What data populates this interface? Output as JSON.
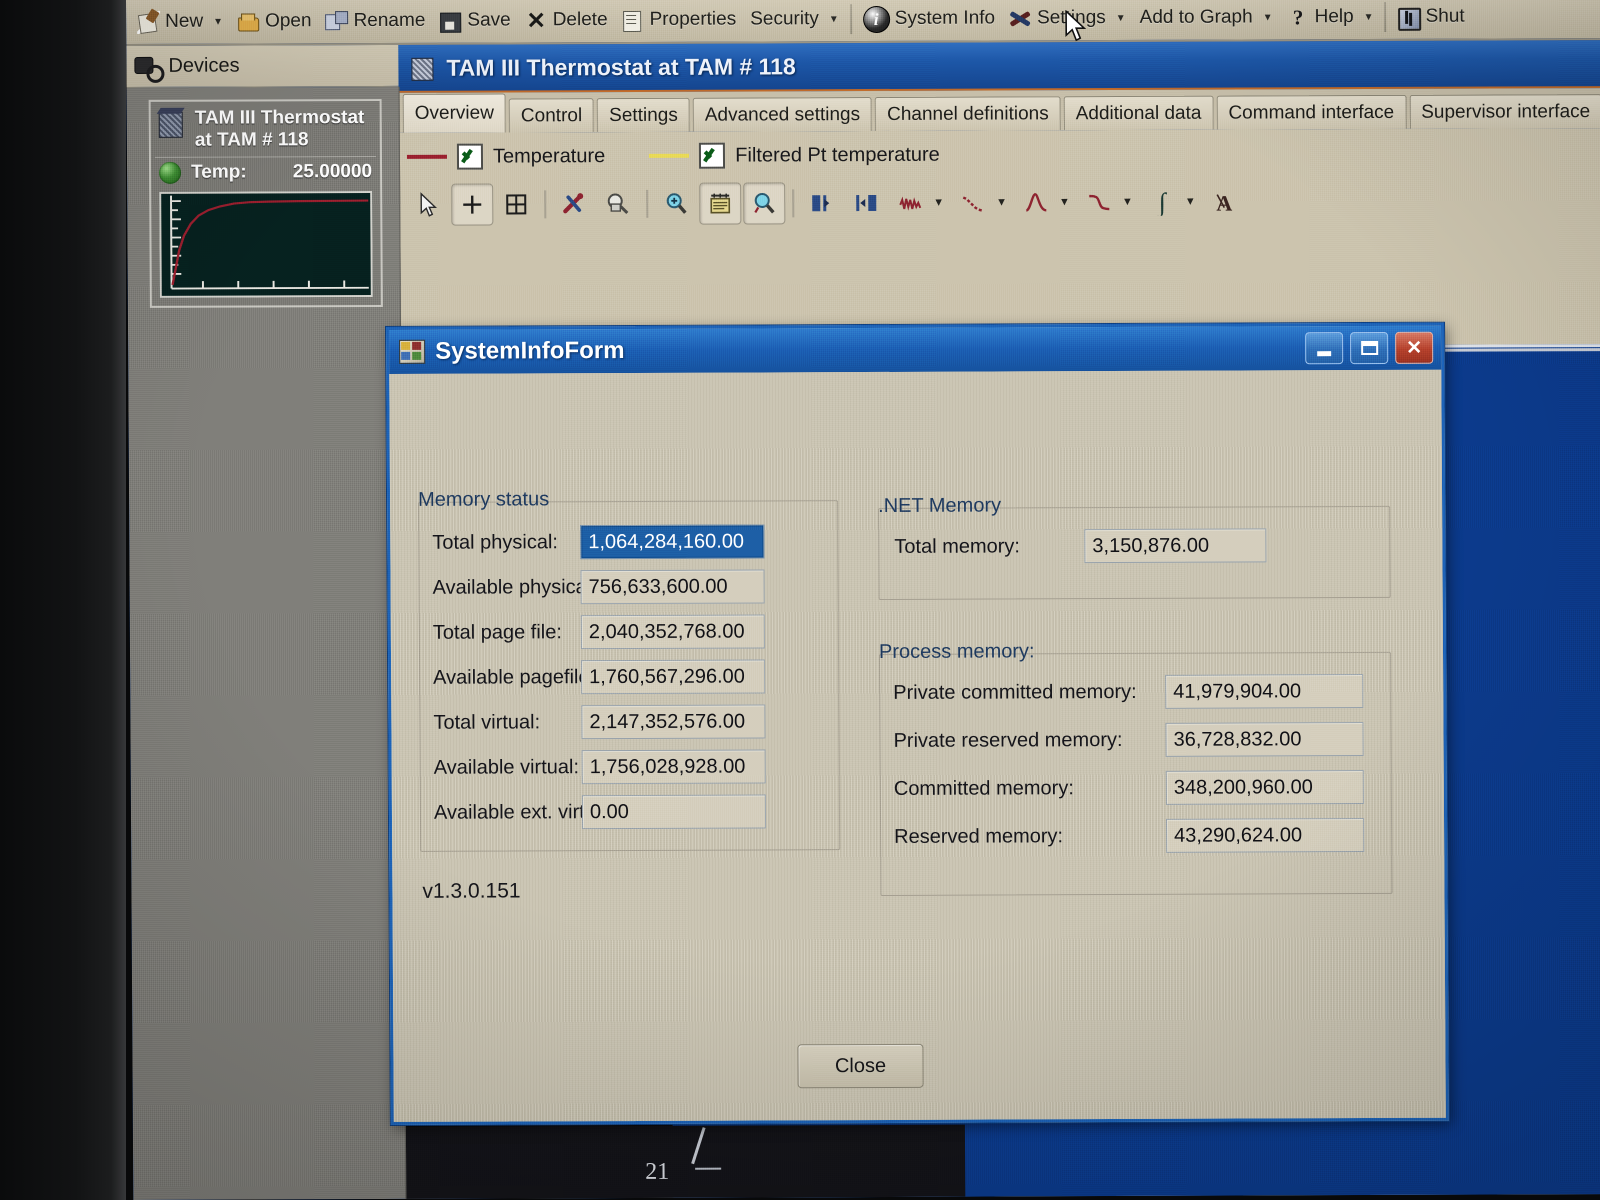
{
  "app": {
    "toolbar": [
      {
        "label": "New",
        "icon": "new-icon",
        "caret": true
      },
      {
        "label": "Open",
        "icon": "open-folder-icon",
        "caret": false
      },
      {
        "label": "Rename",
        "icon": "rename-icon",
        "caret": false
      },
      {
        "label": "Save",
        "icon": "save-disk-icon",
        "caret": false
      },
      {
        "label": "Delete",
        "icon": "delete-x-icon",
        "caret": false
      },
      {
        "label": "Properties",
        "icon": "properties-icon",
        "caret": false
      },
      {
        "label": "Security",
        "icon": "",
        "caret": true
      },
      {
        "label": "System Info",
        "icon": "info-circle-icon",
        "caret": false
      },
      {
        "label": "Settings",
        "icon": "tools-icon",
        "caret": true
      },
      {
        "label": "Add to Graph",
        "icon": "",
        "caret": true
      },
      {
        "label": "Help",
        "icon": "help-question-icon",
        "caret": true
      },
      {
        "label": "Shut",
        "icon": "shutdown-icon",
        "caret": false
      }
    ]
  },
  "devices": {
    "header": "Devices",
    "card": {
      "title_line1": "TAM III Thermostat",
      "title_line2": "at TAM # 118",
      "temp_label": "Temp:",
      "temp_value": "25.00000"
    }
  },
  "document": {
    "title": "TAM III Thermostat at TAM # 118",
    "tabs": [
      {
        "label": "Overview",
        "active": true
      },
      {
        "label": "Control",
        "active": false
      },
      {
        "label": "Settings",
        "active": false
      },
      {
        "label": "Advanced settings",
        "active": false
      },
      {
        "label": "Channel definitions",
        "active": false
      },
      {
        "label": "Additional data",
        "active": false
      },
      {
        "label": "Command interface",
        "active": false
      },
      {
        "label": "Supervisor interface",
        "active": false
      }
    ],
    "legend": [
      {
        "label": "Temperature",
        "color": "#9b1f2e",
        "checked": true
      },
      {
        "label": "Filtered Pt temperature",
        "color": "#e9da56",
        "checked": true
      }
    ],
    "graph_tools": [
      {
        "name": "pointer-tool",
        "pressed": false,
        "caret": false
      },
      {
        "name": "crosshair-tool",
        "pressed": true,
        "caret": false
      },
      {
        "name": "fit-window-tool",
        "pressed": false,
        "caret": false
      },
      {
        "name": "configure-tool",
        "pressed": false,
        "caret": false
      },
      {
        "name": "print-preview-tool",
        "pressed": false,
        "caret": false
      },
      {
        "name": "zoom-in-tool",
        "pressed": false,
        "caret": false
      },
      {
        "name": "legend-tool",
        "pressed": true,
        "caret": false
      },
      {
        "name": "zoom-out-tool",
        "pressed": true,
        "caret": false
      },
      {
        "name": "align-left-tool",
        "pressed": false,
        "caret": false
      },
      {
        "name": "align-right-tool",
        "pressed": false,
        "caret": false
      },
      {
        "name": "noise-curve-tool",
        "pressed": false,
        "caret": true
      },
      {
        "name": "decay-curve-tool",
        "pressed": false,
        "caret": true
      },
      {
        "name": "peak-curve-tool",
        "pressed": false,
        "caret": true
      },
      {
        "name": "step-curve-tool",
        "pressed": false,
        "caret": true
      },
      {
        "name": "integral-tool",
        "pressed": false,
        "caret": true
      },
      {
        "name": "annotation-tool",
        "pressed": false,
        "caret": false
      }
    ],
    "plot_axis_label": "21"
  },
  "dialog": {
    "title": "SystemInfoForm",
    "window_buttons": {
      "minimize": "minimize-button",
      "maximize": "maximize-button",
      "close": "close-button"
    },
    "memory_status": {
      "caption": "Memory status",
      "fields": [
        {
          "label": "Total physical:",
          "value": "1,064,284,160.00",
          "selected": true
        },
        {
          "label": "Available physical:",
          "value": "756,633,600.00",
          "selected": false
        },
        {
          "label": "Total page file:",
          "value": "2,040,352,768.00",
          "selected": false
        },
        {
          "label": "Available pagefile:",
          "value": "1,760,567,296.00",
          "selected": false
        },
        {
          "label": "Total virtual:",
          "value": "2,147,352,576.00",
          "selected": false
        },
        {
          "label": "Available virtual:",
          "value": "1,756,028,928.00",
          "selected": false
        },
        {
          "label": "Available ext. virtual:",
          "value": "0.00",
          "selected": false
        }
      ]
    },
    "net_memory": {
      "caption": ".NET Memory",
      "fields": [
        {
          "label": "Total memory:",
          "value": "3,150,876.00"
        }
      ]
    },
    "process_memory": {
      "caption": "Process memory:",
      "fields": [
        {
          "label": "Private committed memory:",
          "value": "41,979,904.00"
        },
        {
          "label": "Private reserved memory:",
          "value": "36,728,832.00"
        },
        {
          "label": "Committed memory:",
          "value": "348,200,960.00"
        },
        {
          "label": "Reserved memory:",
          "value": "43,290,624.00"
        }
      ]
    },
    "version": "v1.3.0.151",
    "close_label": "Close"
  },
  "colors": {
    "title_blue": "#1c5fb4",
    "desktop_blue": "#0b3a8c",
    "dialog_face": "#cec8b5",
    "toolbar_tan": "#cdc5b0",
    "selection_blue": "#1d5fa6",
    "series_temperature": "#9b1f2e",
    "series_filtered_pt": "#e9da56",
    "led_green": "#3f8f34"
  }
}
